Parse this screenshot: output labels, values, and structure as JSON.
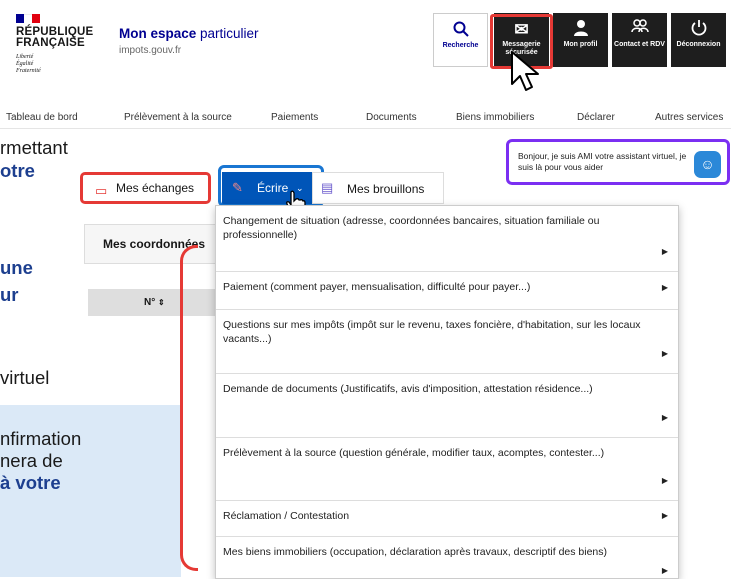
{
  "header": {
    "republique": "RÉPUBLIQUE",
    "francaise": "FRANÇAISE",
    "devise": [
      "Liberté",
      "Égalité",
      "Fraternité"
    ],
    "site_name_1": "Mon espace",
    "site_name_2": " particulier",
    "site_url": "impots.gouv.fr",
    "buttons": {
      "recherche": "Recherche",
      "messagerie": "Messagerie sécurisée",
      "profil": "Mon profil",
      "contact": "Contact et RDV",
      "deconnexion": "Déconnexion"
    }
  },
  "nav": [
    "Tableau de bord",
    "Prélèvement à la source",
    "Paiements",
    "Documents",
    "Biens immobiliers",
    "Déclarer",
    "Autres services"
  ],
  "left_text": {
    "l1": "rmettant",
    "l2": "otre",
    "l3": "une",
    "l4": "ur",
    "l5": "virtuel",
    "l6": "nfirmation",
    "l7": "nera de",
    "l8": "à votre"
  },
  "chat": {
    "text": "Bonjour, je suis AMI votre assistant virtuel, je suis là pour vous aider"
  },
  "tabs": {
    "echanges": "Mes échanges",
    "ecrire": "Écrire",
    "brouillons": "Mes brouillons"
  },
  "coordonnees": "Mes coordonnées",
  "table_header": "N°",
  "menu": [
    "Changement de situation (adresse, coordonnées bancaires, situation familiale ou professionnelle)",
    "Paiement (comment payer, mensualisation, difficulté pour payer...)",
    "Questions sur mes impôts (impôt sur le revenu, taxes foncière, d'habitation, sur les locaux vacants...)",
    "Demande de documents (Justificatifs, avis d'imposition, attestation résidence...)",
    "Prélèvement à la source (question générale, modifier taux, acomptes, contester...)",
    "Réclamation / Contestation",
    "Mes biens immobiliers (occupation, déclaration après travaux, descriptif des biens)"
  ],
  "colors": {
    "marianne_blue": "#000091",
    "accent_red": "#e53935",
    "ecrire_blue": "#0055b8",
    "chat_purple": "#7b2ff2"
  }
}
